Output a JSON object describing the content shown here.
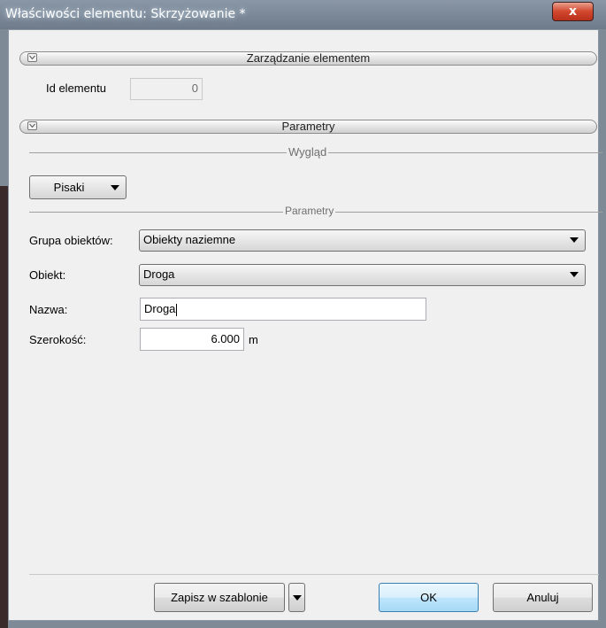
{
  "window": {
    "title": "Właściwości elementu: Skrzyżowanie *",
    "close_glyph": "x"
  },
  "sections": {
    "management": "Zarządzanie elementem",
    "parameters": "Parametry"
  },
  "element_id": {
    "label": "Id elementu",
    "value": "0"
  },
  "appearance": {
    "caption": "Wygląd",
    "pens_button": "Pisaki"
  },
  "params": {
    "caption": "Parametry",
    "group_label": "Grupa obiektów:",
    "group_value": "Obiekty naziemne",
    "object_label": "Obiekt:",
    "object_value": "Droga",
    "name_label": "Nazwa:",
    "name_value": "Droga",
    "width_label": "Szerokość:",
    "width_value": "6.000",
    "width_unit": "m"
  },
  "footer": {
    "save_template": "Zapisz w szablonie",
    "ok": "OK",
    "cancel": "Anuluj"
  }
}
